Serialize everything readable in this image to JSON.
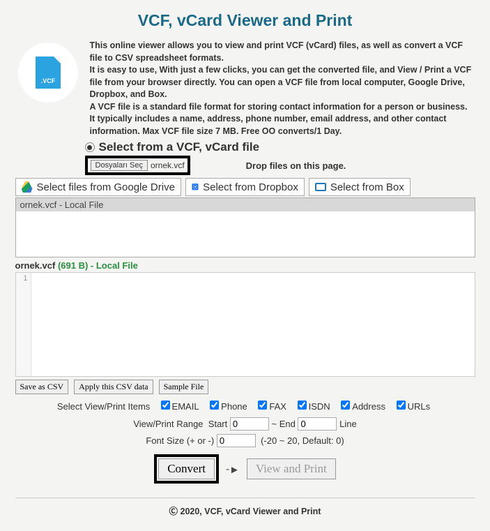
{
  "title": "VCF, vCard Viewer and Print",
  "icon_label": ".VCF",
  "description": {
    "p1": "This online viewer allows you to view and print VCF (vCard) files, as well as convert a VCF file to CSV spreadsheet formats.",
    "p2": "It is easy to use, With just a few clicks, you can get the converted file, and View / Print a VCF file from your browser directly. You can open a VCF file from local computer, Google Drive, Dropbox, and Box.",
    "p3": "A VCF file is a standard file format for storing contact information for a person or business. It typically includes a name, address, phone number, email address, and other contact information. Max VCF file size 7 MB. Free OO converts/1 Day."
  },
  "select_heading": "Select from a VCF, vCard file",
  "file_chooser": {
    "button": "Dosyaları Seç",
    "filename": "ornek.vcf"
  },
  "drop_text": "Drop files on this page.",
  "cloud": {
    "gdrive": "Select files from Google Drive",
    "dropbox": "Select from Dropbox",
    "box": "Select from Box"
  },
  "file_list_item": "ornek.vcf - Local File",
  "file_status": {
    "name": "ornek.vcf",
    "size": "(691 B)",
    "source": " - Local File"
  },
  "csv_gutter": "1",
  "buttons": {
    "save_csv": "Save as CSV",
    "apply_csv": "Apply this CSV data",
    "sample": "Sample File"
  },
  "options": {
    "select_label": "Select View/Print Items",
    "items": {
      "email": "EMAIL",
      "phone": "Phone",
      "fax": "FAX",
      "isdn": "ISDN",
      "address": "Address",
      "urls": "URLs"
    },
    "range_label": "View/Print Range",
    "start_label": "Start",
    "start_val": "0",
    "end_label": "~ End",
    "end_val": "0",
    "line_label": "Line",
    "font_label": "Font Size (+ or -)",
    "font_val": "0",
    "font_hint": "(-20 ~ 20, Default: 0)"
  },
  "actions": {
    "convert": "Convert",
    "arrow": "-->",
    "view_print": "View and Print"
  },
  "footer": "Ⓒ 2020, VCF, vCard Viewer and Print"
}
